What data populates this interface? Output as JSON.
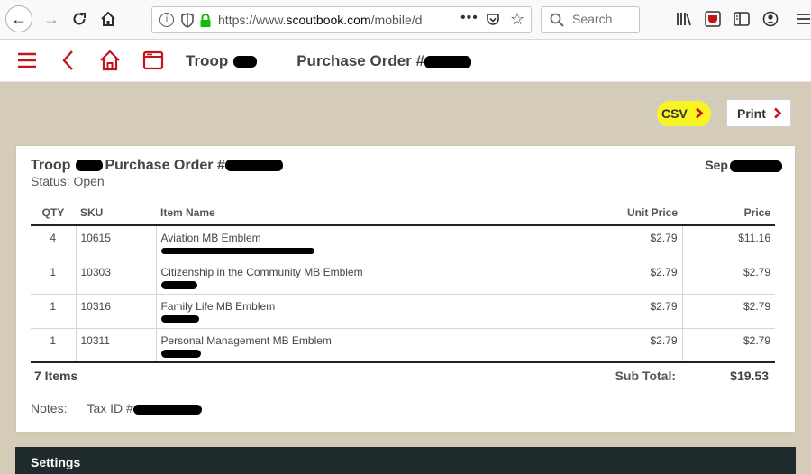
{
  "browser": {
    "url_scheme": "https://www.",
    "url_host": "scoutbook.com",
    "url_path": "/mobile/d",
    "url_menu": "•••",
    "search_placeholder": "Search"
  },
  "header": {
    "title_prefix": "Troop",
    "title_mid": "Purchase Order #"
  },
  "actions": {
    "csv_label": "CSV",
    "print_label": "Print",
    "csv_highlight_color": "#f8f523",
    "chevron_color": "#c0161b"
  },
  "order": {
    "title_prefix": "Troop",
    "title_mid": "Purchase Order #",
    "status": "Status: Open",
    "date_prefix": "Sep",
    "columns": [
      "QTY",
      "SKU",
      "Item Name",
      "Unit Price",
      "Price"
    ],
    "rows": [
      {
        "qty": "4",
        "sku": "10615",
        "name": "Aviation MB Emblem",
        "unit_price": "$2.79",
        "price": "$11.16"
      },
      {
        "qty": "1",
        "sku": "10303",
        "name": "Citizenship in the Community MB Emblem",
        "unit_price": "$2.79",
        "price": "$2.79"
      },
      {
        "qty": "1",
        "sku": "10316",
        "name": "Family Life MB Emblem",
        "unit_price": "$2.79",
        "price": "$2.79"
      },
      {
        "qty": "1",
        "sku": "10311",
        "name": "Personal Management MB Emblem",
        "unit_price": "$2.79",
        "price": "$2.79"
      }
    ],
    "items_count": "7 Items",
    "subtotal_label": "Sub Total:",
    "subtotal_value": "$19.53",
    "notes_label": "Notes:",
    "tax_prefix": "Tax ID #"
  },
  "settings": {
    "label": "Settings"
  },
  "colors": {
    "background": "#d4cbb8",
    "accent_red": "#c0161b",
    "settings_bar": "#1f2a2d"
  }
}
